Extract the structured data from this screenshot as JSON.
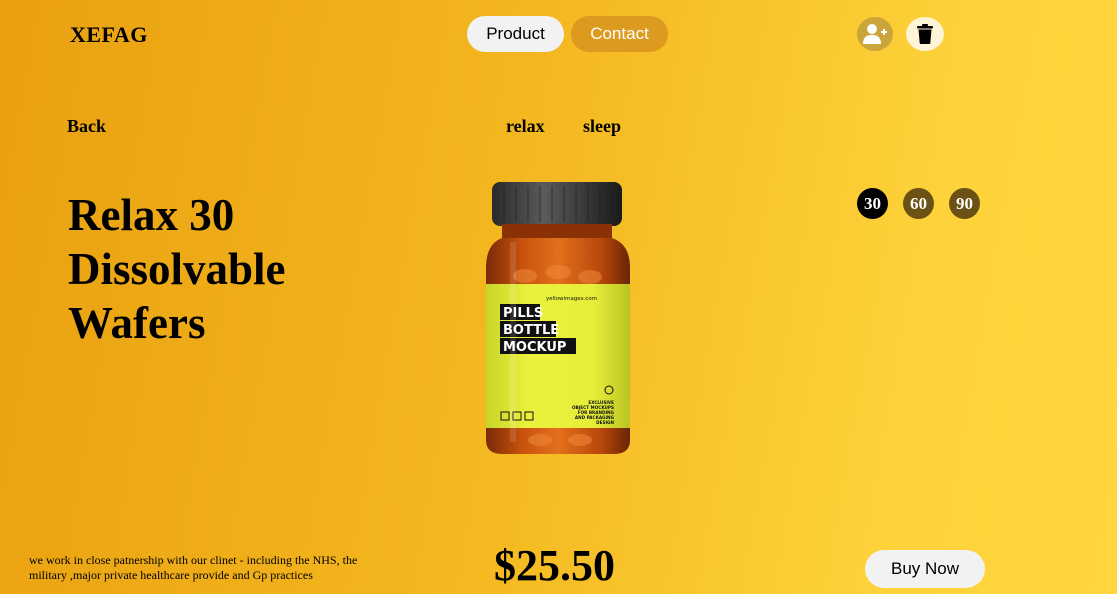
{
  "brand": {
    "logo": "XEFAG"
  },
  "nav": {
    "product": "Product",
    "contact": "Contact"
  },
  "icons": {
    "user": "add-user-icon",
    "trash": "trash-icon"
  },
  "back": "Back",
  "tags": [
    "relax",
    "sleep"
  ],
  "product": {
    "title_lines": [
      "Relax 30",
      "Dissolvable",
      "Wafers"
    ],
    "sizes": [
      "30",
      "60",
      "90"
    ],
    "selected_size": "30",
    "image_label": {
      "site": "yellowimages.com",
      "headline": [
        "PILLS",
        "BOTTLE",
        "MOCKUP"
      ],
      "note": [
        "EXCLUSIVE",
        "OBJECT MOCKUPS",
        "FOR BRANDING",
        "AND PACKAGING",
        "DESIGN"
      ]
    },
    "price": "$25.50",
    "buy_label": "Buy Now"
  },
  "description": "we work in close patnership with our clinet - including the NHS, the military ,major private healthcare provide and Gp practices",
  "colors": {
    "background_start": "#e9a010",
    "background_end": "#ffd63d",
    "contact_button": "#dc9a1e",
    "size_selected": "#000000",
    "size_other": "#6b5214",
    "label_yellow": "#e4ee3a"
  }
}
